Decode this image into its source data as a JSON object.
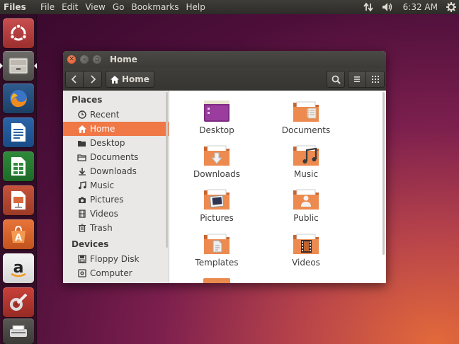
{
  "top_panel": {
    "app_name": "Files",
    "menus": [
      "File",
      "Edit",
      "View",
      "Go",
      "Bookmarks",
      "Help"
    ],
    "clock": "6:32 AM",
    "indicators": [
      "network-icon",
      "volume-icon",
      "gear-icon"
    ]
  },
  "launcher": {
    "items": [
      "ubuntu-dash-icon",
      "files-icon",
      "firefox-icon",
      "writer-icon",
      "calc-icon",
      "impress-icon",
      "software-center-icon",
      "amazon-icon",
      "settings-icon",
      "scanner-icon"
    ]
  },
  "window": {
    "title": "Home",
    "path": "Home",
    "sidebar": {
      "places_label": "Places",
      "places": [
        {
          "label": "Recent",
          "icon": "clock-icon"
        },
        {
          "label": "Home",
          "icon": "home-icon"
        },
        {
          "label": "Desktop",
          "icon": "desktop-icon"
        },
        {
          "label": "Documents",
          "icon": "documents-icon"
        },
        {
          "label": "Downloads",
          "icon": "download-icon"
        },
        {
          "label": "Music",
          "icon": "music-icon"
        },
        {
          "label": "Pictures",
          "icon": "camera-icon"
        },
        {
          "label": "Videos",
          "icon": "film-icon"
        },
        {
          "label": "Trash",
          "icon": "trash-icon"
        }
      ],
      "active": "Home",
      "devices_label": "Devices",
      "devices": [
        {
          "label": "Floppy Disk",
          "icon": "floppy-icon"
        },
        {
          "label": "Computer",
          "icon": "computer-icon"
        }
      ]
    },
    "files": [
      {
        "label": "Desktop",
        "icon": "desktop-folder-icon"
      },
      {
        "label": "Documents",
        "icon": "documents-folder-icon"
      },
      {
        "label": "Downloads",
        "icon": "downloads-folder-icon"
      },
      {
        "label": "Music",
        "icon": "music-folder-icon"
      },
      {
        "label": "Pictures",
        "icon": "pictures-folder-icon"
      },
      {
        "label": "Public",
        "icon": "public-folder-icon"
      },
      {
        "label": "Templates",
        "icon": "templates-folder-icon"
      },
      {
        "label": "Videos",
        "icon": "videos-folder-icon"
      }
    ]
  },
  "colors": {
    "accent": "#f07746",
    "folder": "#e98a4e",
    "panel": "#3c3b37",
    "desktop_purple": "#7c1f4e"
  }
}
